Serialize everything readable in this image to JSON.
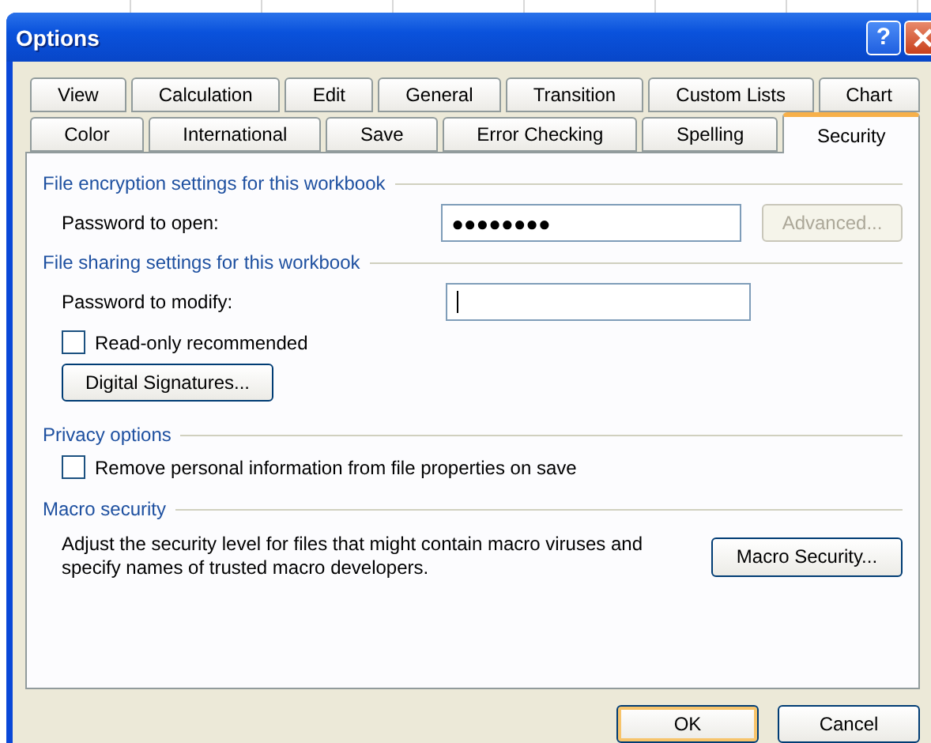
{
  "window": {
    "title": "Options",
    "help": "?"
  },
  "tab_rows": [
    [
      {
        "label": "View",
        "selected": false
      },
      {
        "label": "Calculation",
        "selected": false
      },
      {
        "label": "Edit",
        "selected": false
      },
      {
        "label": "General",
        "selected": false
      },
      {
        "label": "Transition",
        "selected": false
      },
      {
        "label": "Custom Lists",
        "selected": false
      },
      {
        "label": "Chart",
        "selected": false
      }
    ],
    [
      {
        "label": "Color",
        "selected": false
      },
      {
        "label": "International",
        "selected": false
      },
      {
        "label": "Save",
        "selected": false
      },
      {
        "label": "Error Checking",
        "selected": false
      },
      {
        "label": "Spelling",
        "selected": false
      },
      {
        "label": "Security",
        "selected": true
      }
    ]
  ],
  "encryption": {
    "heading": "File encryption settings for this workbook",
    "password_label": "Password to open:",
    "password_value": "●●●●●●●●",
    "advanced_button": {
      "label": "Advanced...",
      "disabled": true
    }
  },
  "sharing": {
    "heading": "File sharing settings for this workbook",
    "password_label": "Password to modify:",
    "focused": true,
    "read_only": {
      "label": "Read-only recommended",
      "checked": false
    },
    "signatures_button": "Digital Signatures..."
  },
  "privacy": {
    "heading": "Privacy options",
    "remove_info": {
      "label": "Remove personal information from file properties on save",
      "checked": false
    }
  },
  "macro": {
    "heading": "Macro security",
    "description": "Adjust the security level for files that might contain macro viruses and specify names of trusted macro developers.",
    "button": "Macro Security..."
  },
  "buttons": [
    {
      "label": "OK",
      "default": true
    },
    {
      "label": "Cancel",
      "default": false
    }
  ]
}
